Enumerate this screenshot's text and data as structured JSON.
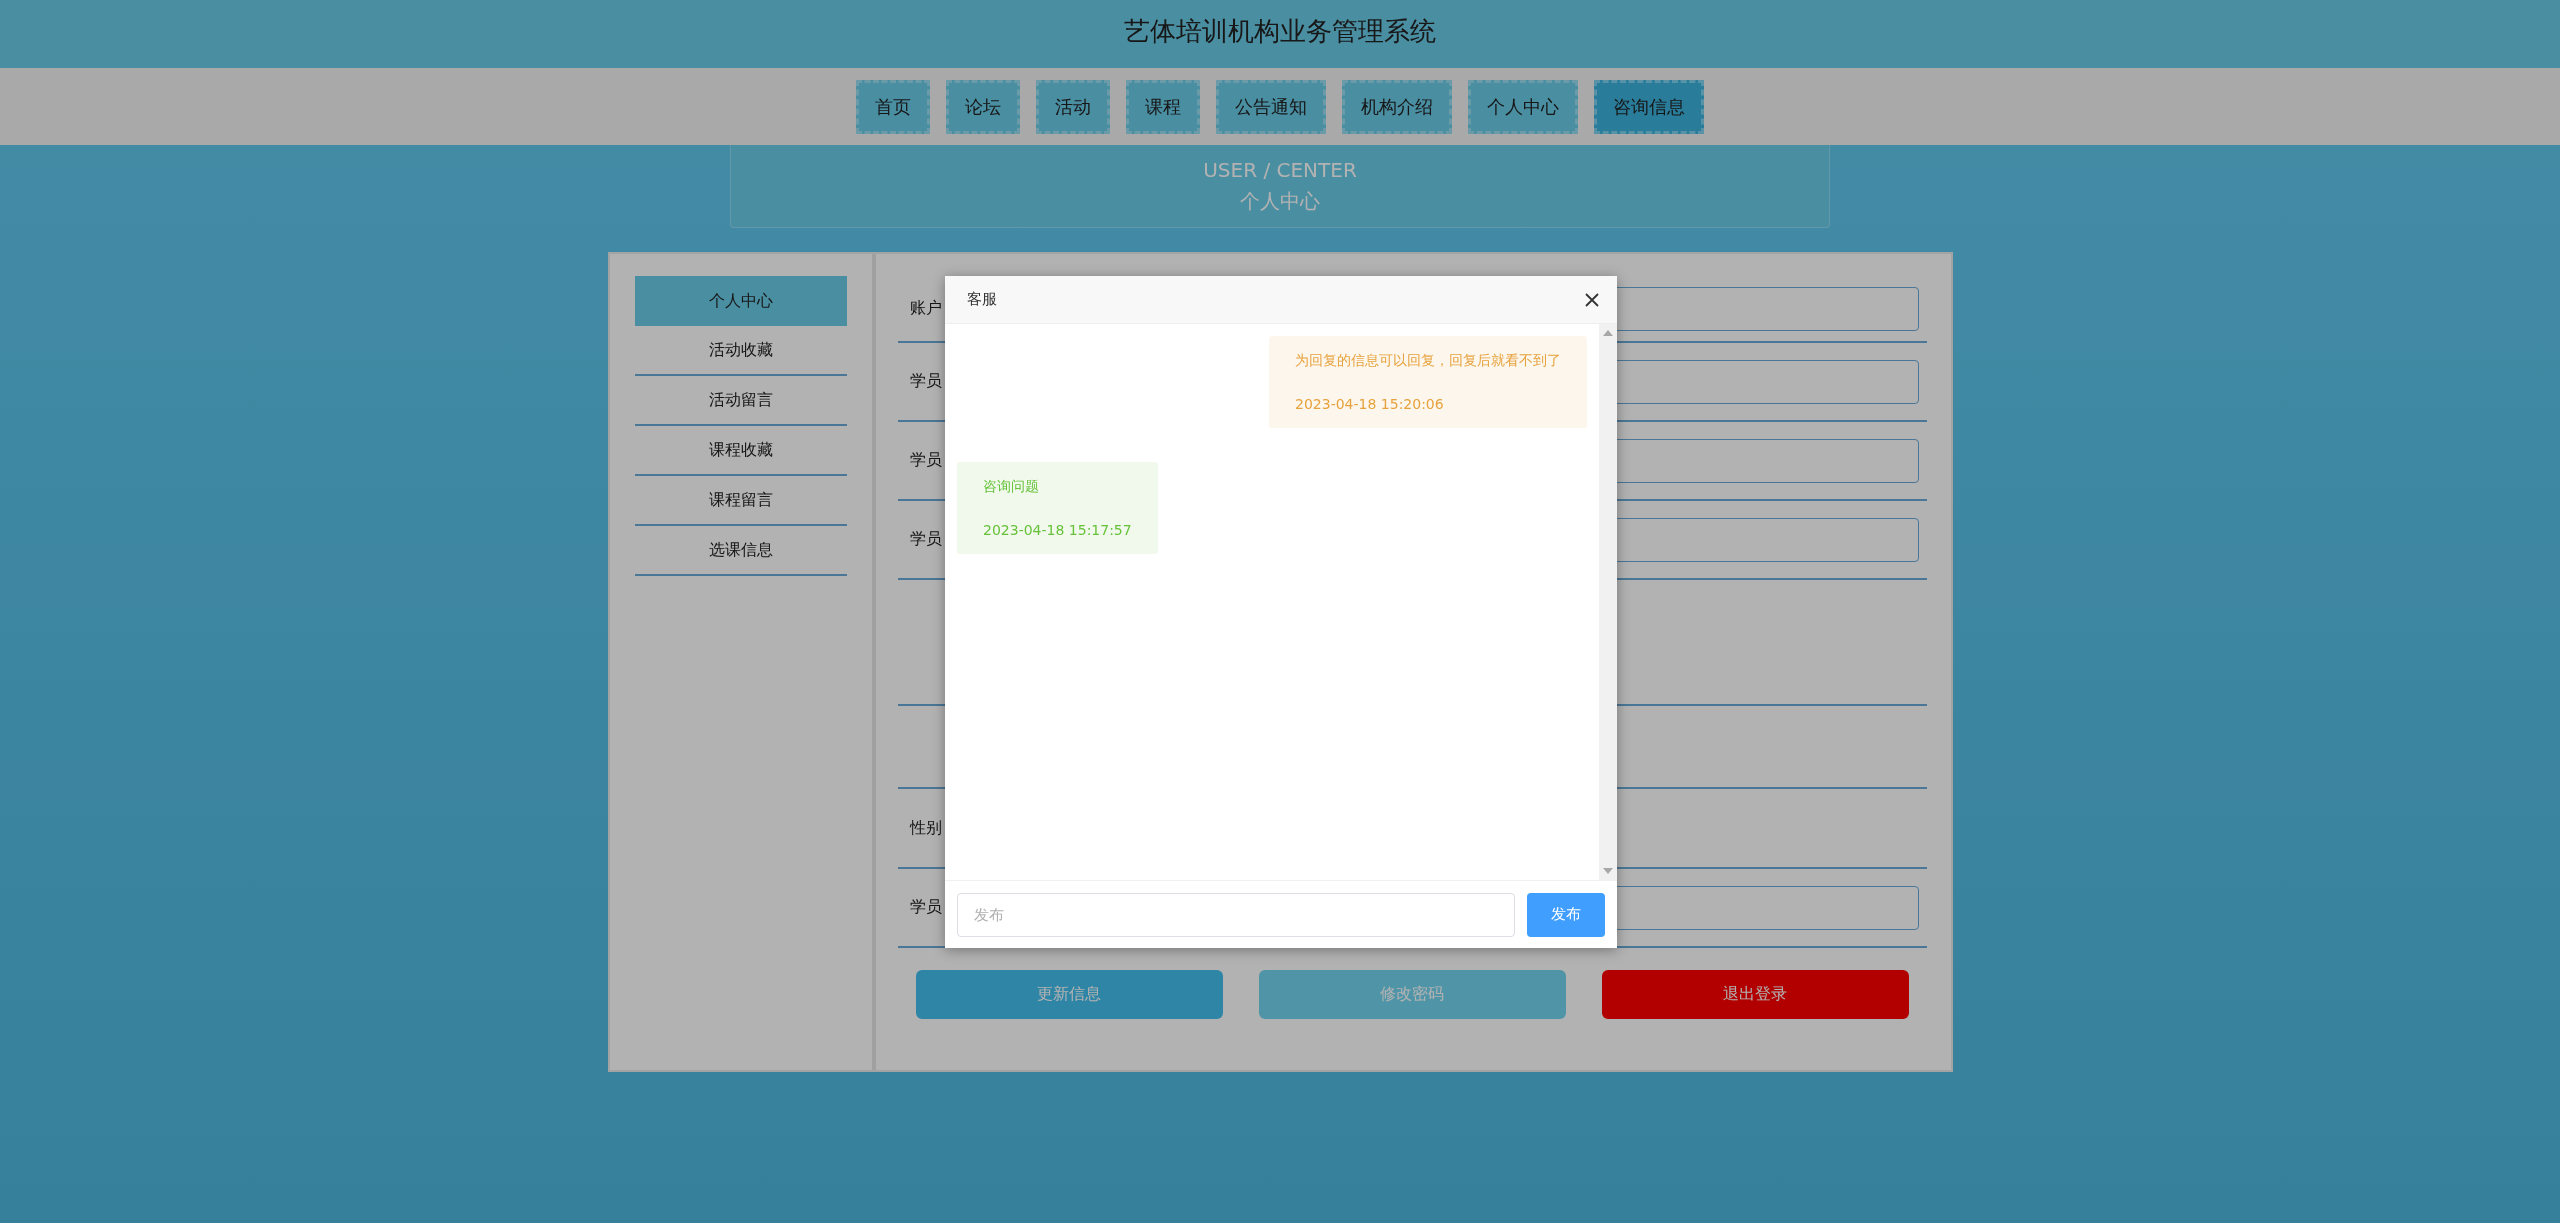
{
  "site": {
    "title": "艺体培训机构业务管理系统"
  },
  "nav": [
    {
      "label": "首页",
      "selected": false
    },
    {
      "label": "论坛",
      "selected": false
    },
    {
      "label": "活动",
      "selected": false
    },
    {
      "label": "课程",
      "selected": false
    },
    {
      "label": "公告通知",
      "selected": false
    },
    {
      "label": "机构介绍",
      "selected": false
    },
    {
      "label": "个人中心",
      "selected": false
    },
    {
      "label": "咨询信息",
      "selected": true
    }
  ],
  "banner": {
    "subtitle": "USER / CENTER",
    "title": "个人中心"
  },
  "sidebar": [
    {
      "label": "个人中心",
      "selected": true
    },
    {
      "label": "活动收藏",
      "selected": false
    },
    {
      "label": "活动留言",
      "selected": false
    },
    {
      "label": "课程收藏",
      "selected": false
    },
    {
      "label": "课程留言",
      "selected": false
    },
    {
      "label": "选课信息",
      "selected": false
    }
  ],
  "form": {
    "rows": [
      {
        "kind": "input",
        "label": "账户"
      },
      {
        "kind": "input",
        "label": "学员"
      },
      {
        "kind": "input",
        "label": "学员"
      },
      {
        "kind": "input",
        "label": "学员"
      },
      {
        "kind": "tall"
      },
      {
        "kind": "blank"
      },
      {
        "kind": "plain",
        "label": "性别"
      },
      {
        "kind": "input",
        "label": "学员"
      }
    ],
    "buttons": [
      {
        "label": "更新信息",
        "kind": "primary"
      },
      {
        "label": "修改密码",
        "kind": "secondary"
      },
      {
        "label": "退出登录",
        "kind": "danger"
      }
    ]
  },
  "dialog": {
    "title": "客服",
    "messages": [
      {
        "kind": "outgoing",
        "text": "为回复的信息可以回复，回复后就看不到了",
        "time": "2023-04-18 15:20:06"
      },
      {
        "kind": "incoming",
        "text": "咨询问题",
        "time": "2023-04-18 15:17:57"
      }
    ],
    "input": {
      "placeholder": "发布"
    },
    "send": "发布"
  }
}
